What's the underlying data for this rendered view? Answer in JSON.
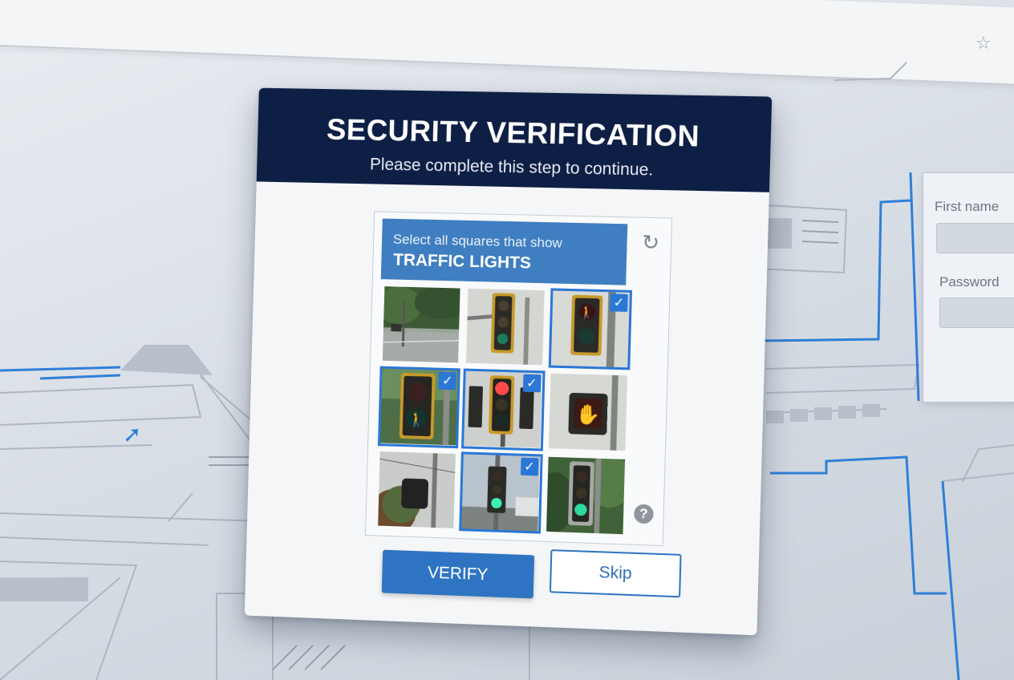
{
  "background": {
    "form": {
      "first_name_label": "First name",
      "password_label": "Password"
    }
  },
  "modal": {
    "title": "SECURITY VERIFICATION",
    "subtitle": "Please complete this step to continue."
  },
  "captcha": {
    "instruction": "Select all squares that show",
    "target": "TRAFFIC LIGHTS",
    "refresh_icon": "refresh-icon",
    "help_icon": "help-icon",
    "help_glyph": "?",
    "tiles": [
      {
        "scene": "street-corner",
        "selected": false
      },
      {
        "scene": "traffic-light-on-pole-green",
        "selected": false
      },
      {
        "scene": "pedestrian-signal-red",
        "selected": true
      },
      {
        "scene": "pedestrian-signal-walk",
        "selected": true
      },
      {
        "scene": "traffic-light-red",
        "selected": true
      },
      {
        "scene": "dont-walk-hand-signal",
        "selected": false
      },
      {
        "scene": "trees-with-signal",
        "selected": false
      },
      {
        "scene": "traffic-light-green-street",
        "selected": true
      },
      {
        "scene": "traffic-light-green-trees",
        "selected": false
      }
    ]
  },
  "buttons": {
    "verify": "VERIFY",
    "skip": "Skip"
  },
  "colors": {
    "header": "#0e1f45",
    "accent": "#2e74c2",
    "prompt": "#3f7ec0"
  }
}
